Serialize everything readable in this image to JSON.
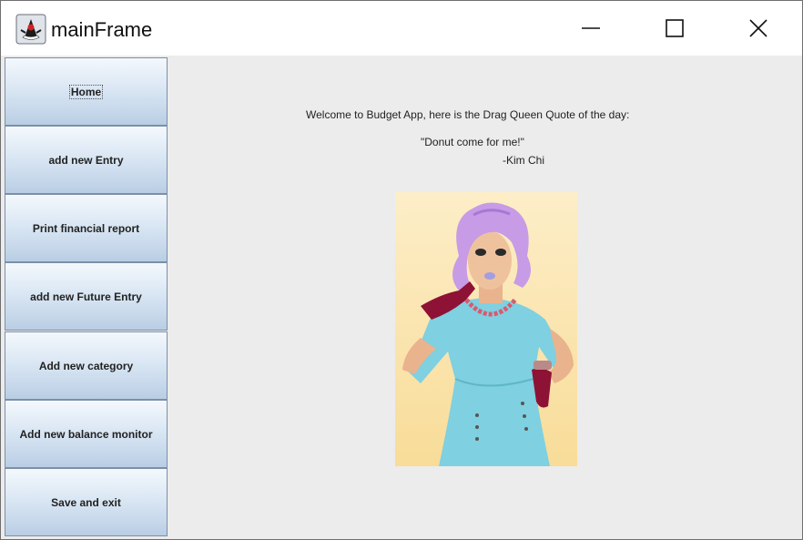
{
  "window": {
    "title": "mainFrame",
    "icon": "java-duke-icon",
    "controls": [
      "minimize-icon",
      "maximize-icon",
      "close-icon"
    ]
  },
  "sidebar": {
    "items": [
      {
        "label": "Home",
        "focused": true
      },
      {
        "label": "add new Entry"
      },
      {
        "label": "Print financial report"
      },
      {
        "label": "add new Future Entry"
      },
      {
        "label": "Add new category"
      },
      {
        "label": "Add new balance monitor"
      },
      {
        "label": "Save and exit"
      }
    ]
  },
  "main": {
    "welcome_text": "Welcome to Budget App, here is the Drag Queen Quote of the day:",
    "quote": "\"Donut come for me!\"",
    "author": "-Kim Chi",
    "image": "drag-queen-portrait"
  },
  "colors": {
    "content_bg": "#ececec",
    "button_gradient_top": "#f4f8fc",
    "button_gradient_bottom": "#b9cde3",
    "button_border": "#7b8fa8",
    "photo_bg": "#fbe6b8",
    "dress": "#7fd0e0",
    "wig": "#c79be6",
    "gloves": "#8e1235"
  }
}
